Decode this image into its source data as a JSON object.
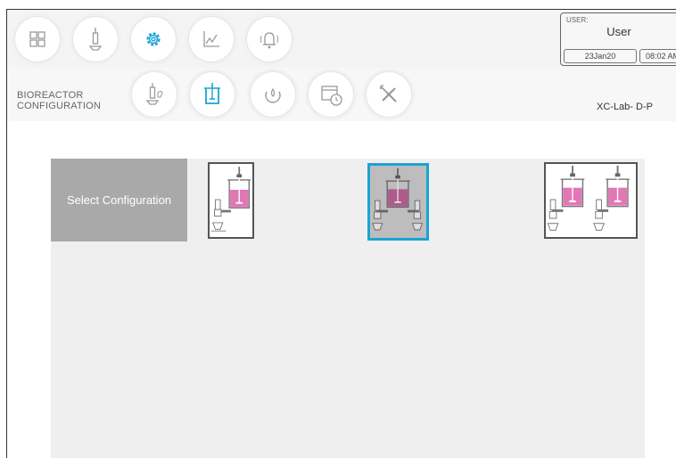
{
  "nav": {
    "top": [
      {
        "icon": "dashboard-grid-icon"
      },
      {
        "icon": "sensor-probe-icon"
      },
      {
        "icon": "gear-icon",
        "active": true
      },
      {
        "icon": "trend-chart-icon"
      },
      {
        "icon": "alarm-bell-icon"
      }
    ],
    "sub": [
      {
        "icon": "probe-calibration-icon"
      },
      {
        "icon": "bioreactor-vessel-icon",
        "active": true
      },
      {
        "icon": "recycle-loop-icon"
      },
      {
        "icon": "calendar-schedule-icon"
      },
      {
        "icon": "wrench-tools-icon"
      }
    ]
  },
  "user": {
    "caption": "USER:",
    "name": "User",
    "date": "23Jan20",
    "time": "08:02 AM"
  },
  "page": {
    "title_line1": "BIOREACTOR",
    "title_line2": "CONFIGURATION",
    "device": "XC-Lab- D-P"
  },
  "config": {
    "select_label": "Select Configuration",
    "options": [
      {
        "name": "single-vessel",
        "selected": false
      },
      {
        "name": "single-vessel-dual-probes",
        "selected": true
      },
      {
        "name": "dual-vessel",
        "selected": false
      }
    ]
  },
  "colors": {
    "accent": "#1aa3d6",
    "liquid": "#e277b5",
    "liquid_dim": "#b05a8c",
    "select_bg": "#a9a9a9",
    "panel_bg": "#efefef"
  }
}
